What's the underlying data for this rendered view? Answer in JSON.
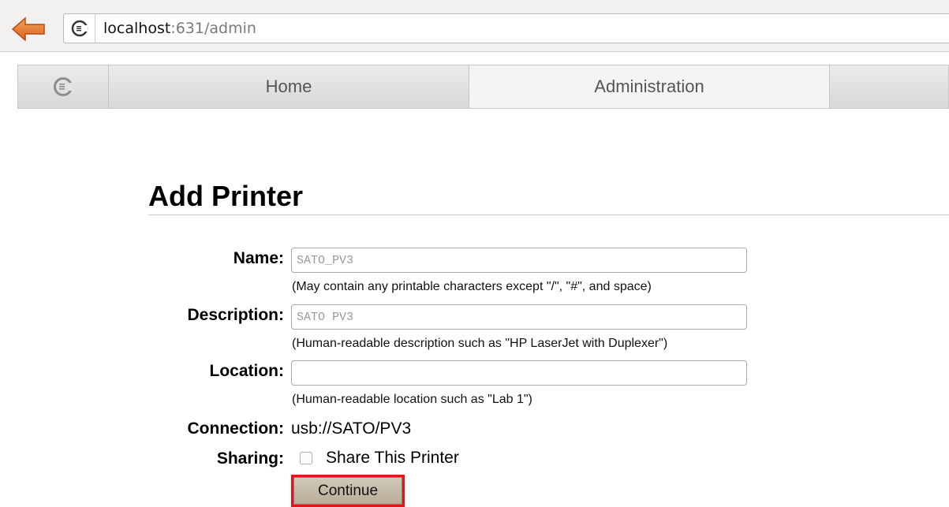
{
  "browser": {
    "url_host": "localhost",
    "url_rest": ":631/admin"
  },
  "nav": {
    "tabs": [
      {
        "label": "Home"
      },
      {
        "label": "Administration"
      }
    ]
  },
  "page": {
    "title": "Add Printer"
  },
  "form": {
    "name": {
      "label": "Name:",
      "value": "SATO_PV3",
      "hint": "(May contain any printable characters except \"/\", \"#\", and space)"
    },
    "description": {
      "label": "Description:",
      "value": "SATO PV3",
      "hint": "(Human-readable description such as \"HP LaserJet with Duplexer\")"
    },
    "location": {
      "label": "Location:",
      "value": "",
      "hint": "(Human-readable location such as \"Lab 1\")"
    },
    "connection": {
      "label": "Connection:",
      "value": "usb://SATO/PV3"
    },
    "sharing": {
      "label": "Sharing:",
      "checkbox_label": "Share This Printer",
      "checked": false
    },
    "continue_label": "Continue"
  },
  "colors": {
    "highlight_border": "#e0161b",
    "back_arrow": "#e8741e"
  }
}
